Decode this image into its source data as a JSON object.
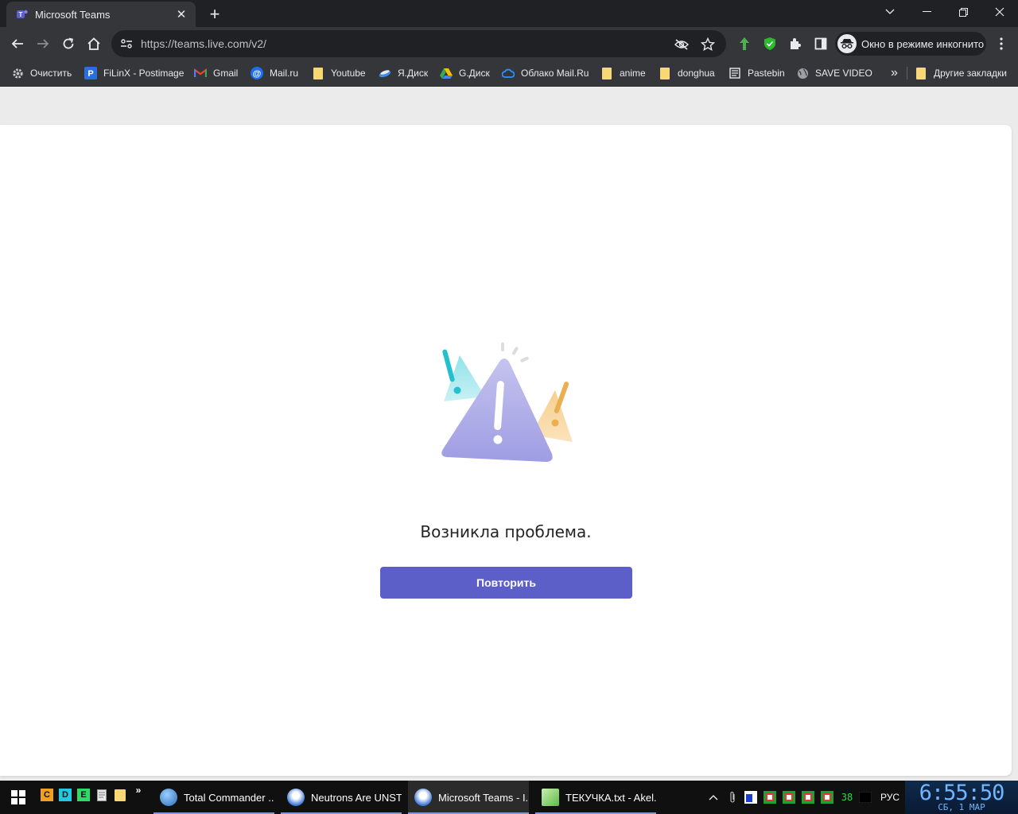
{
  "browser": {
    "tab": {
      "title": "Microsoft Teams",
      "close_glyph": "✕"
    },
    "new_tab_glyph": "+",
    "url": "https://teams.live.com/v2/",
    "incognito_label": "Окно в режиме инкогнито"
  },
  "bookmarks": {
    "items": [
      {
        "label": "Очистить",
        "icon": "gear-icon"
      },
      {
        "label": "FiLinX - Postimage",
        "icon": "postimage-icon"
      },
      {
        "label": "Gmail",
        "icon": "gmail-icon"
      },
      {
        "label": "Mail.ru",
        "icon": "mailru-icon"
      },
      {
        "label": "Youtube",
        "icon": "folder-icon"
      },
      {
        "label": "Я.Диск",
        "icon": "yadisk-icon"
      },
      {
        "label": "G.Диск",
        "icon": "gdrive-icon"
      },
      {
        "label": "Облако Mail.Ru",
        "icon": "cloud-icon"
      },
      {
        "label": "anime",
        "icon": "folder-icon"
      },
      {
        "label": "donghua",
        "icon": "folder-icon"
      },
      {
        "label": "Pastebin",
        "icon": "pastebin-icon"
      },
      {
        "label": "SAVE VIDEO",
        "icon": "globe-icon"
      }
    ],
    "overflow_glyph": "»",
    "other_label": "Другие закладки"
  },
  "page": {
    "error_title": "Возникла проблема.",
    "retry_label": "Повторить",
    "accent": "#5b5fc7"
  },
  "taskbar": {
    "quicklaunch": [
      "C",
      "D",
      "E"
    ],
    "quicklaunch_more": "»",
    "tasks": [
      {
        "label": "Total Commander ..."
      },
      {
        "label": "Neutrons Are UNST..."
      },
      {
        "label": "Microsoft Teams - I..."
      },
      {
        "label": "ТЕКУЧКА.txt - Akel..."
      }
    ],
    "tray_number": "38",
    "language": "РУС",
    "time": "6:55:50",
    "date": "СБ, 1  МАР"
  }
}
